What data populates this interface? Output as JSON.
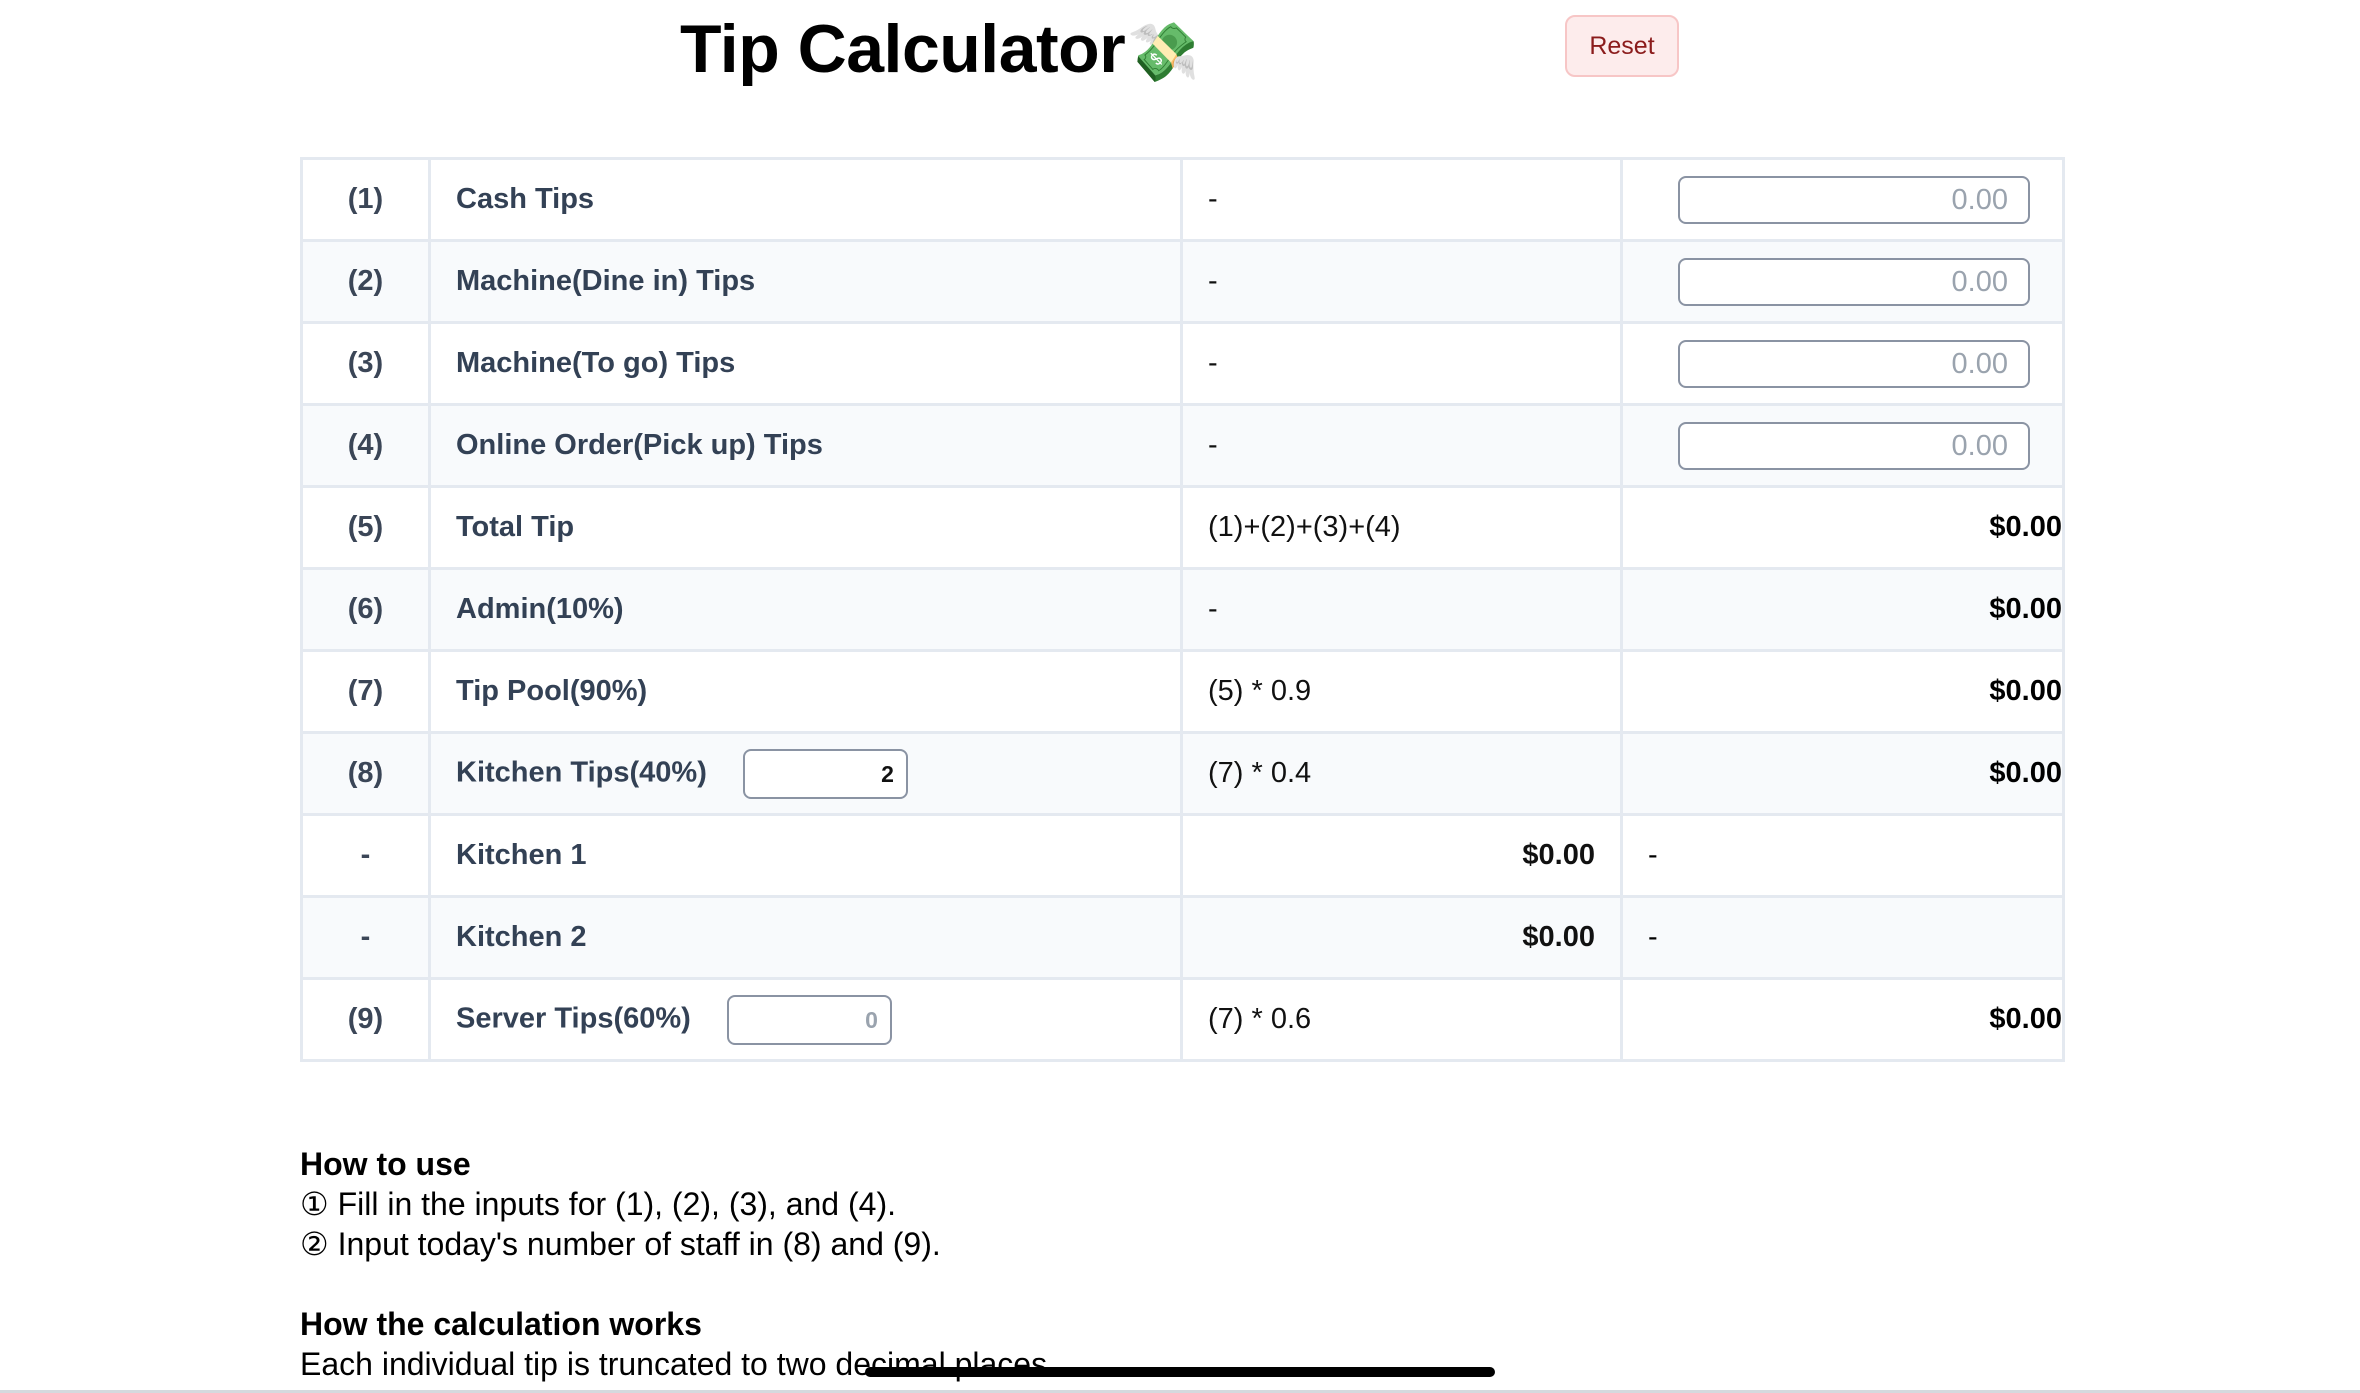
{
  "header": {
    "title": "Tip Calculator",
    "title_emoji": "💸",
    "reset_label": "Reset"
  },
  "input_placeholder": "0.00",
  "rows": [
    {
      "num": "(1)",
      "label": "Cash Tips",
      "formula": "-",
      "input": "0.00"
    },
    {
      "num": "(2)",
      "label": "Machine(Dine in) Tips",
      "formula": "-",
      "input": "0.00"
    },
    {
      "num": "(3)",
      "label": "Machine(To go) Tips",
      "formula": "-",
      "input": "0.00"
    },
    {
      "num": "(4)",
      "label": "Online Order(Pick up) Tips",
      "formula": "-",
      "input": "0.00"
    },
    {
      "num": "(5)",
      "label": "Total Tip",
      "formula": "(1)+(2)+(3)+(4)",
      "value": "$0.00"
    },
    {
      "num": "(6)",
      "label": "Admin(10%)",
      "formula": "-",
      "value": "$0.00"
    },
    {
      "num": "(7)",
      "label": "Tip Pool(90%)",
      "formula": "(5) * 0.9",
      "value": "$0.00"
    },
    {
      "num": "(8)",
      "label": "Kitchen Tips(40%)",
      "staff_count": "2",
      "formula": "(7) * 0.4",
      "value": "$0.00"
    },
    {
      "num": "-",
      "label": "Kitchen 1",
      "amount": "$0.00",
      "value": "-"
    },
    {
      "num": "-",
      "label": "Kitchen 2",
      "amount": "$0.00",
      "value": "-"
    },
    {
      "num": "(9)",
      "label": "Server Tips(60%)",
      "staff_placeholder": "0",
      "formula": "(7) * 0.6",
      "value": "$0.00"
    }
  ],
  "how_to_use": {
    "heading": "How to use",
    "step1": "① Fill in the inputs for (1), (2), (3), and (4).",
    "step2": "② Input today's number of staff in (8) and (9)."
  },
  "how_calc": {
    "heading": "How the calculation works",
    "line1": "Each individual tip is truncated to two decimal places."
  }
}
